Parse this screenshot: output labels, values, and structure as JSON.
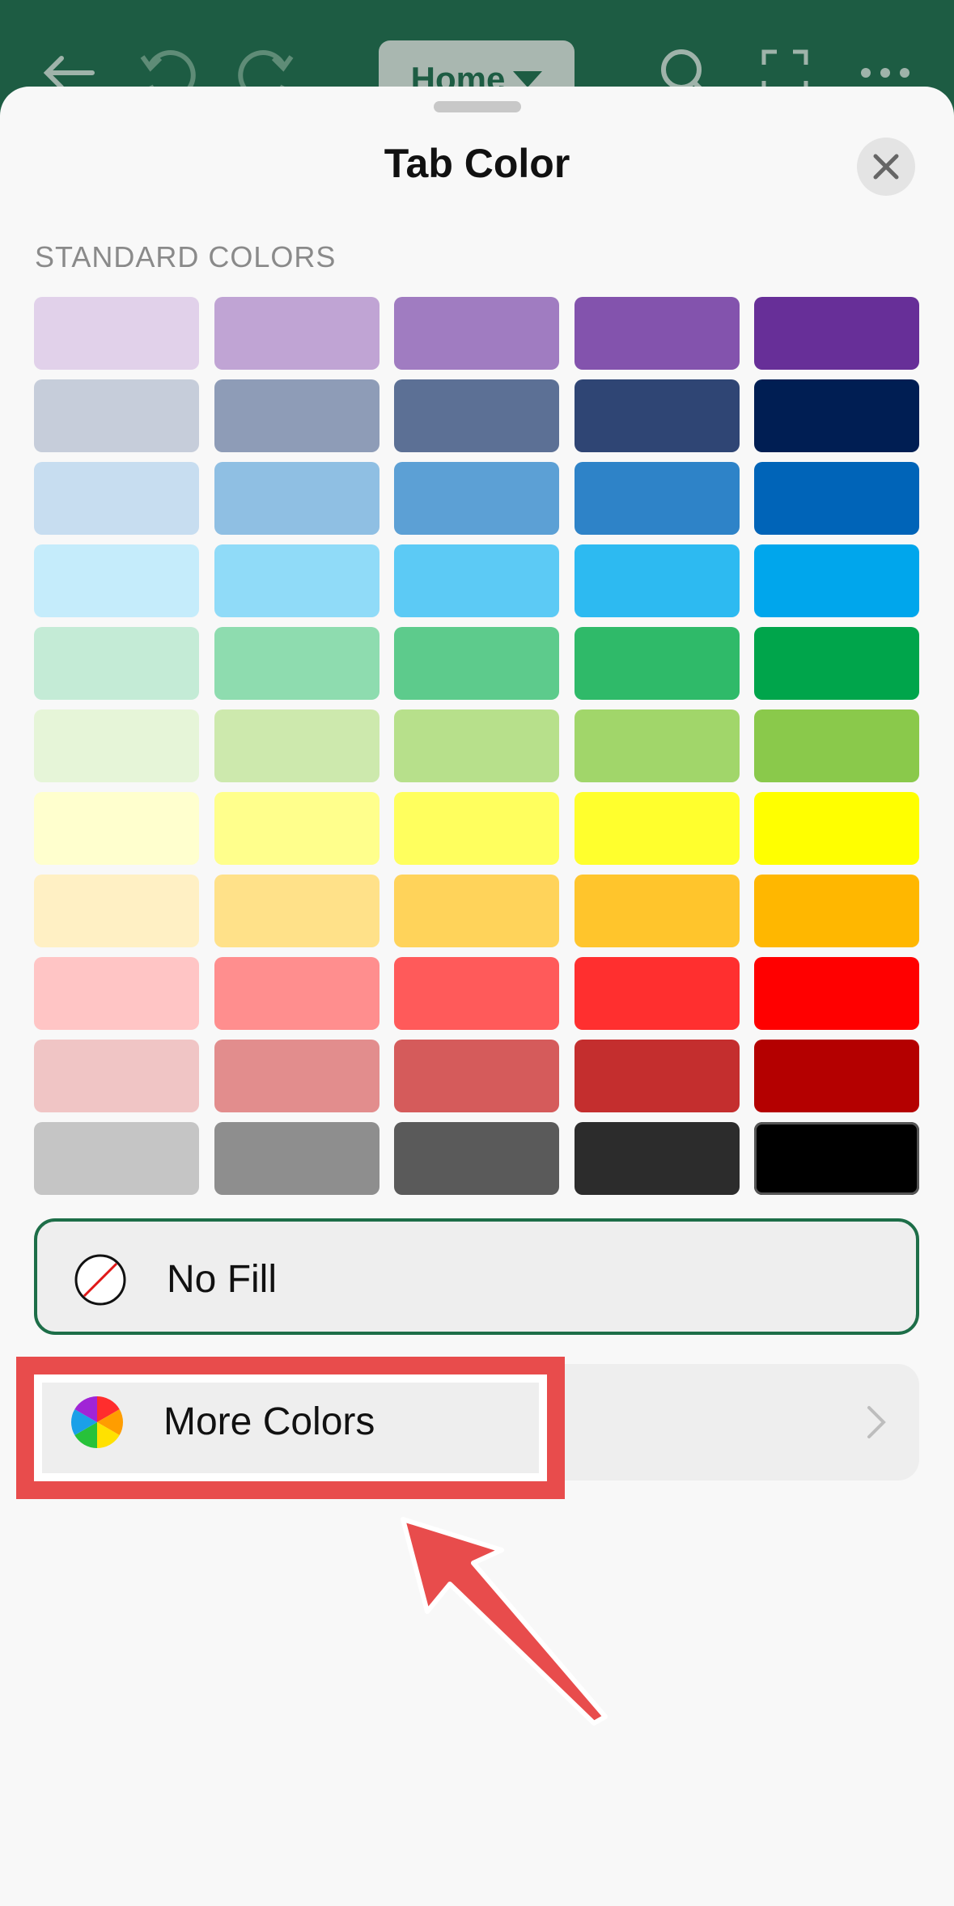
{
  "toolbar": {
    "home_label": "Home",
    "icons": [
      "back-icon",
      "undo-icon",
      "redo-icon",
      "search-icon",
      "expand-icon",
      "more-icon"
    ]
  },
  "sheet": {
    "title": "Tab Color",
    "section_label": "STANDARD COLORS",
    "swatches": [
      [
        "#e1d1ea",
        "#c0a4d4",
        "#a07cc1",
        "#8353ad",
        "#672f98"
      ],
      [
        "#c6cdda",
        "#8e9cb7",
        "#5c7095",
        "#2f4574",
        "#001e53"
      ],
      [
        "#c7ddf0",
        "#8fbfe3",
        "#5ca0d5",
        "#2e83c8",
        "#0064b8"
      ],
      [
        "#c5ecfb",
        "#90dbf8",
        "#5ccaf5",
        "#2dbaf1",
        "#00a6ec"
      ],
      [
        "#c4ebd6",
        "#8edcaf",
        "#5dcb8c",
        "#2fba69",
        "#00a54b"
      ],
      [
        "#e6f5d8",
        "#cde9ad",
        "#b7e08b",
        "#a1d66a",
        "#8ac94b"
      ],
      [
        "#ffffce",
        "#ffff8c",
        "#ffff5e",
        "#ffff2d",
        "#ffff00"
      ],
      [
        "#fff0c4",
        "#ffe189",
        "#ffd35a",
        "#ffc52c",
        "#ffb700"
      ],
      [
        "#ffc5c5",
        "#ff8e8e",
        "#ff5a5a",
        "#ff2f2f",
        "#ff0000"
      ],
      [
        "#f0c5c5",
        "#e28d8d",
        "#d55b5b",
        "#c42e2e",
        "#b40000"
      ],
      [
        "#c5c5c5",
        "#8e8e8e",
        "#5a5a5a",
        "#2c2c2c",
        "#000000"
      ]
    ],
    "options": {
      "no_fill_label": "No Fill",
      "more_colors_label": "More Colors"
    }
  },
  "colors": {
    "toolbar_bg": "#1d5c43",
    "selected_outline": "#1d6e48",
    "annotation_red": "#e84c4c"
  }
}
